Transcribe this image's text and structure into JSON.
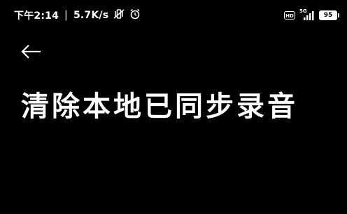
{
  "status_bar": {
    "time": "下午2:14",
    "separator": "|",
    "network_speed": "5.7K/s",
    "icons": [
      "mute-vibrate-icon",
      "alarm-icon",
      "hd-voice-icon",
      "5g-signal-icon",
      "battery-icon"
    ],
    "hd_label": "HD",
    "network_type": "5G",
    "battery_level": "95"
  },
  "header": {
    "back_icon": "back-arrow-icon"
  },
  "page": {
    "title": "清除本地已同步录音"
  },
  "colors": {
    "background": "#000000",
    "foreground": "#ffffff"
  }
}
